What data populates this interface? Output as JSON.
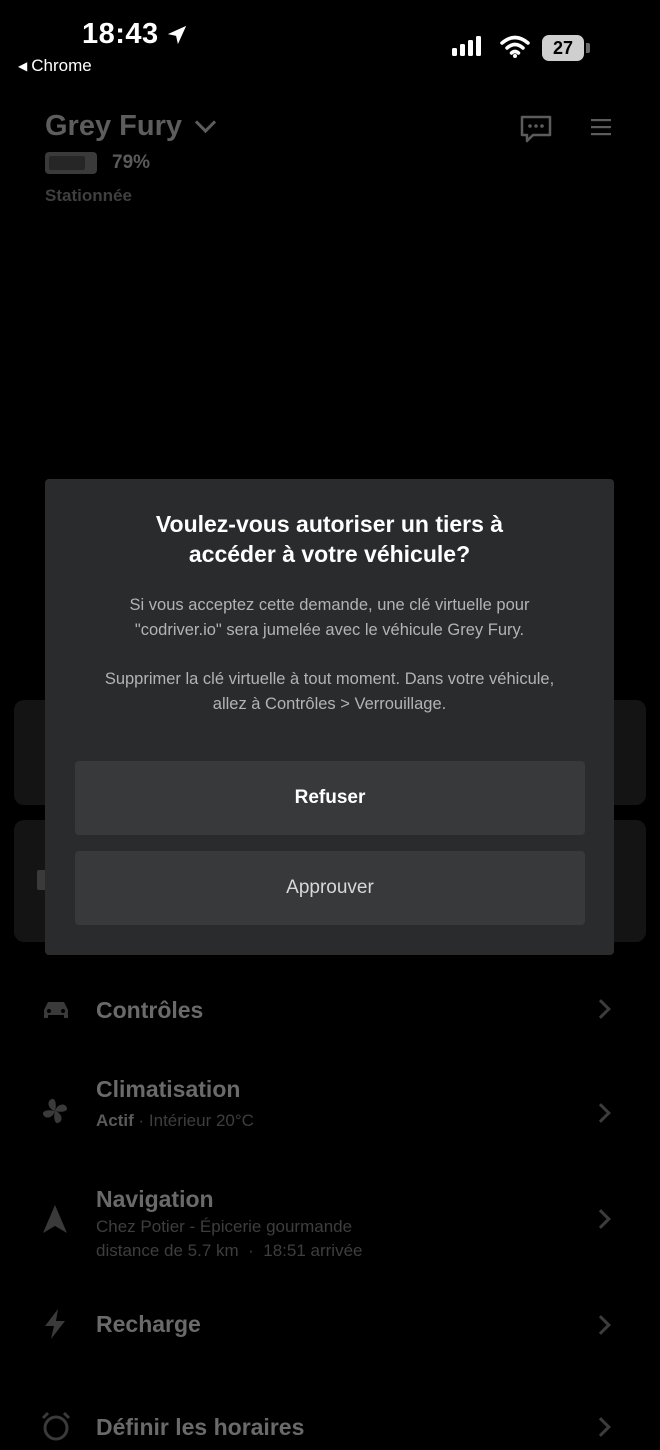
{
  "status_bar": {
    "time": "18:43",
    "back_app": "Chrome",
    "battery_level": "27"
  },
  "vehicle": {
    "name": "Grey Fury",
    "battery_pct": "79%",
    "state": "Stationnée"
  },
  "menu": [
    {
      "title": "Contrôles",
      "icon": "car-icon"
    },
    {
      "title": "Climatisation",
      "status": "Actif",
      "detail": " · Intérieur 20°C",
      "icon": "fan-icon"
    },
    {
      "title": "Navigation",
      "line1": "Chez Potier - Épicerie gourmande",
      "line2": "distance de 5.7 km  ·  18:51 arrivée",
      "icon": "navigation-arrow-icon"
    },
    {
      "title": "Recharge",
      "icon": "lightning-icon"
    },
    {
      "title": "Définir les horaires",
      "icon": "alarm-clock-icon"
    }
  ],
  "dialog": {
    "title_line1": "Voulez-vous autoriser un tiers à",
    "title_line2": "accéder à votre véhicule?",
    "para1_line1": "Si vous acceptez cette demande, une clé virtuelle pour",
    "para1_line2": "\"codriver.io\" sera jumelée avec le véhicule Grey Fury.",
    "para2_line1": "Supprimer la clé virtuelle à tout moment. Dans votre véhicule,",
    "para2_line2": "allez à Contrôles > Verrouillage.",
    "refuse_label": "Refuser",
    "approve_label": "Approuver"
  },
  "colors": {
    "background": "#000000",
    "dialog_bg": "#2a2b2d",
    "button_bg": "#38393b"
  }
}
